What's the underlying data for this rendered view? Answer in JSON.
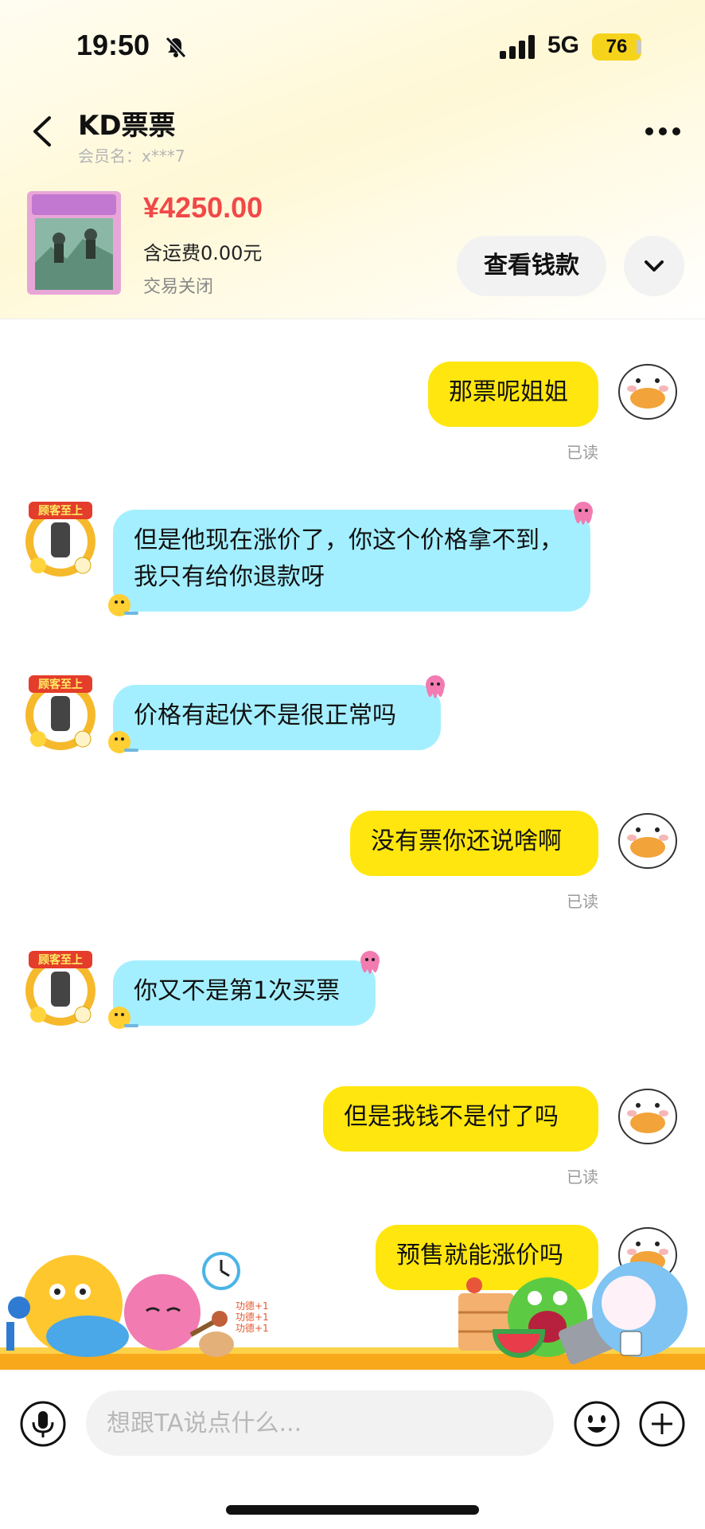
{
  "status_bar": {
    "time": "19:50",
    "network": "5G",
    "battery": "76"
  },
  "header": {
    "title": "KD票票",
    "subtitle": "会员名：x***7"
  },
  "order": {
    "price": "¥4250.00",
    "shipping": "含运费0.00元",
    "status": "交易关闭",
    "view_button": "查看钱款"
  },
  "messages": [
    {
      "side": "mine",
      "text": "那票呢姐姐",
      "read": "已读"
    },
    {
      "side": "theirs",
      "text": "但是他现在涨价了，你这个价格拿不到，我只有给你退款呀"
    },
    {
      "side": "theirs",
      "text": "价格有起伏不是很正常吗"
    },
    {
      "side": "mine",
      "text": "没有票你还说啥啊",
      "read": "已读"
    },
    {
      "side": "theirs",
      "text": "你又不是第1次买票"
    },
    {
      "side": "mine",
      "text": "但是我钱不是付了吗",
      "read": "已读"
    },
    {
      "side": "mine",
      "text": "预售就能涨价吗"
    }
  ],
  "badge_text": "顾客至上",
  "decor_text": [
    "功德+1",
    "功德+1",
    "功德+1"
  ],
  "input": {
    "placeholder": "想跟TA说点什么..."
  },
  "colors": {
    "accent": "#ffe60f",
    "their_bubble": "#a4efff",
    "price": "#f14848"
  }
}
